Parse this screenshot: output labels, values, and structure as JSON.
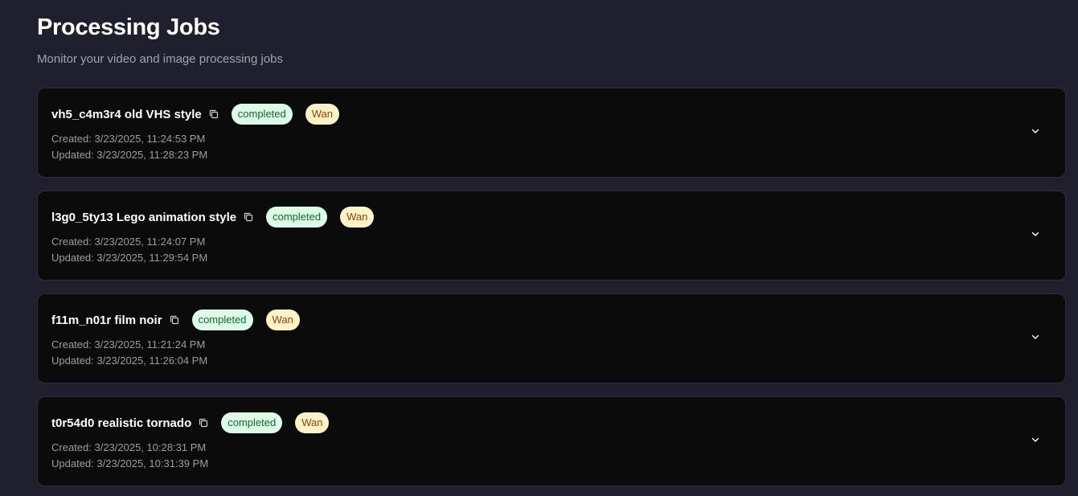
{
  "header": {
    "title": "Processing Jobs",
    "subtitle": "Monitor your video and image processing jobs"
  },
  "colors": {
    "background": "#201f2e",
    "card": "#0b0b0c",
    "status_completed_bg": "#dcfce7",
    "status_completed_text": "#166534",
    "model_bg": "#fef3c7",
    "model_text": "#92400e"
  },
  "icons": {
    "copy": "copy-icon",
    "expand": "chevron-down-icon"
  },
  "jobs": [
    {
      "name": "vh5_c4m3r4 old VHS style",
      "status": "completed",
      "model": "Wan",
      "created": "Created: 3/23/2025, 11:24:53 PM",
      "updated": "Updated: 3/23/2025, 11:28:23 PM"
    },
    {
      "name": "l3g0_5ty13 Lego animation style",
      "status": "completed",
      "model": "Wan",
      "created": "Created: 3/23/2025, 11:24:07 PM",
      "updated": "Updated: 3/23/2025, 11:29:54 PM"
    },
    {
      "name": "f11m_n01r film noir",
      "status": "completed",
      "model": "Wan",
      "created": "Created: 3/23/2025, 11:21:24 PM",
      "updated": "Updated: 3/23/2025, 11:26:04 PM"
    },
    {
      "name": "t0r54d0 realistic tornado",
      "status": "completed",
      "model": "Wan",
      "created": "Created: 3/23/2025, 10:28:31 PM",
      "updated": "Updated: 3/23/2025, 10:31:39 PM"
    }
  ]
}
